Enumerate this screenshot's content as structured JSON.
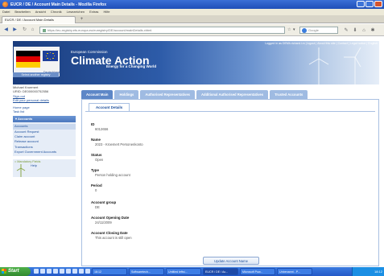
{
  "window": {
    "title": "EUCR / DE / Account Main Details - Mozilla Firefox"
  },
  "menu": [
    "Datei",
    "Bearbeiten",
    "Ansicht",
    "Chronik",
    "Lesezeichen",
    "Extras",
    "Hilfe"
  ],
  "browser_tab": {
    "label": "EUCR / DE / Account Main Details",
    "new_tab": "+"
  },
  "nav": {
    "url": "https://eu-registry.ets.europa.eu/euregistry/DE/account/mainDetails.xhtml",
    "search_placeholder": "Google"
  },
  "banner": {
    "top_links": "Logged in as DEMh.richard.l.m | logout | About this site | Contact | Legal notice | English",
    "country": "Deutschland",
    "select_registry": "Select another registry",
    "commission": "European Commission",
    "title": "Climate Action",
    "subtitle": "Energy for a Changing World"
  },
  "sidebar": {
    "user_name": "Michael Kroemert",
    "user_id": "URID: DE000000752556",
    "sign_out": "Sign-out",
    "edit_details": "Edit your personal details",
    "home": "Home page",
    "task_list": "Task list",
    "section_title": "Accounts",
    "items": [
      {
        "label": "Accounts",
        "active": true
      },
      {
        "label": "Account Request",
        "active": false
      },
      {
        "label": "Claim account",
        "active": false
      },
      {
        "label": "Release account",
        "active": false
      },
      {
        "label": "Transactions",
        "active": false
      },
      {
        "label": "Export Government Accounts",
        "active": false
      }
    ],
    "mandatory": "= Mandatory Fields",
    "help": "Help"
  },
  "main": {
    "tabs": [
      {
        "label": "Account Main",
        "selected": true
      },
      {
        "label": "Holdings",
        "selected": false
      },
      {
        "label": "Authorised Representatives",
        "selected": false
      },
      {
        "label": "Additional Authorised Representatives",
        "selected": false
      },
      {
        "label": "Trusted Accounts",
        "selected": false
      }
    ],
    "subtab": "Account Details",
    "fields": [
      {
        "label": "ID",
        "value": "6012656"
      },
      {
        "label": "Name",
        "value": "2023 - Kroemert Personenkonto"
      },
      {
        "label": "Status",
        "value": "Open"
      },
      {
        "label": "Type",
        "value": "Person holding account"
      },
      {
        "label": "Period",
        "value": "0"
      },
      {
        "label": "Account group",
        "value": "DE"
      },
      {
        "label": "Account Opening Date",
        "value": "24/11/2009"
      },
      {
        "label": "Account Closing Date",
        "value": "This account is still open"
      }
    ],
    "update_button": "Update Account Name"
  },
  "taskbar": {
    "start": "Start",
    "buttons": [
      "18:12",
      "Softwaretech...",
      "Untitled leftsi...",
      "EUCR / DE / Ac...",
      "Microsoft Pow...",
      "Unbenannt - P..."
    ],
    "clock": "18:12"
  },
  "colors": {
    "banner_dark": "#1a3c7c",
    "tab_selected": "#5d87c7",
    "tab": "#9fbbe2",
    "link": "#1d4f9c"
  }
}
